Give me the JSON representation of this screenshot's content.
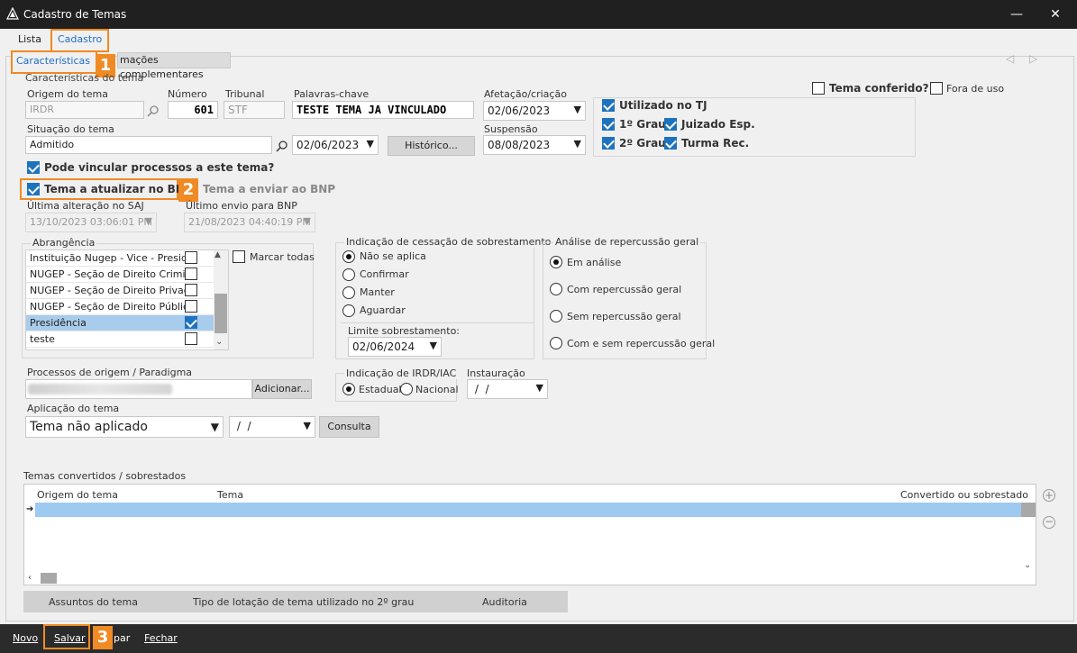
{
  "window": {
    "title": "Cadastro de Temas",
    "minimize": "—",
    "close": "✕"
  },
  "tabs": {
    "lista": "Lista",
    "cadastro": "Cadastro"
  },
  "subtabs": {
    "caracteristicas": "Características",
    "complementares": "mações complementares"
  },
  "badges": [
    "1",
    "2",
    "3"
  ],
  "caracteristicas_group": "Características do tema",
  "origem": {
    "label": "Origem do tema",
    "value": "IRDR"
  },
  "numero": {
    "label": "Número",
    "value": "601"
  },
  "tribunal": {
    "label": "Tribunal",
    "value": "STF"
  },
  "palavras": {
    "label": "Palavras-chave",
    "value": "TESTE TEMA JA VINCULADO"
  },
  "afetacao": {
    "label": "Afetação/criação",
    "value": "02/06/2023"
  },
  "suspensao": {
    "label": "Suspensão",
    "value": "08/08/2023"
  },
  "situacao": {
    "label": "Situação do tema",
    "value": "Admitido",
    "date": "02/06/2023"
  },
  "historico_btn": "Histórico...",
  "tema_conferido": "Tema conferido?",
  "fora_de_uso": "Fora de uso",
  "utilizado_tj": "Utilizado no TJ",
  "grau1": "1º Grau",
  "grau2": "2º Grau",
  "juizado": "Juizado Esp.",
  "turma": "Turma Rec.",
  "pode_vincular": "Pode vincular processos a este tema?",
  "tema_atualizar": "Tema a atualizar no BNP",
  "tema_enviar": "Tema a enviar ao BNP",
  "ultima_alteracao": {
    "label": "Última alteração no SAJ",
    "value": "13/10/2023 03:06:01 PM"
  },
  "ultimo_envio": {
    "label": "Último envio para BNP",
    "value": "21/08/2023 04:40:19 PM"
  },
  "abrangencia": {
    "label": "Abrangência",
    "marcar_todas": "Marcar todas",
    "items": [
      {
        "text": "Instituição Nugep - Vice - Preside",
        "checked": false
      },
      {
        "text": "NUGEP - Seção de Direito Crimin",
        "checked": false
      },
      {
        "text": "NUGEP - Seção de Direito Privado",
        "checked": false
      },
      {
        "text": "NUGEP - Seção de Direito Público",
        "checked": false
      },
      {
        "text": "Presidência",
        "checked": true
      },
      {
        "text": "teste",
        "checked": false
      }
    ]
  },
  "cessacao": {
    "label": "Indicação de cessação de sobrestamento",
    "options": [
      "Não se aplica",
      "Confirmar",
      "Manter",
      "Aguardar"
    ],
    "limite_label": "Limite sobrestamento:",
    "limite_value": "02/06/2024"
  },
  "repercussao": {
    "label": "Análise de repercussão geral",
    "options": [
      "Em análise",
      "Com repercussão geral",
      "Sem repercussão geral",
      "Com e sem repercussão geral"
    ]
  },
  "processos": {
    "label": "Processos de origem / Paradigma",
    "btn": "Adicionar..."
  },
  "irdr": {
    "label": "Indicação de IRDR/IAC",
    "estadual": "Estadual",
    "nacional": "Nacional"
  },
  "instauracao": {
    "label": "Instauração",
    "value": " /  / "
  },
  "aplicacao": {
    "label": "Aplicação do tema",
    "value": "Tema não aplicado",
    "date": " /  / ",
    "btn": "Consulta"
  },
  "convertidos": {
    "label": "Temas convertidos / sobrestados",
    "headers": [
      "Origem do tema",
      "Tema",
      "Convertido ou sobrestado"
    ]
  },
  "bottom_tabs": [
    "Assuntos do tema",
    "Tipo de lotação de tema utilizado no 2º grau",
    "Auditoria"
  ],
  "footer": {
    "novo": "Novo",
    "salvar": "Salvar",
    "par": "par",
    "fechar": "Fechar"
  }
}
